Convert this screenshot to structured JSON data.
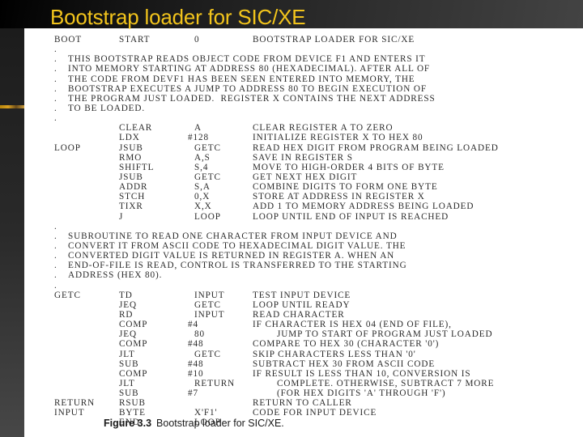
{
  "slide": {
    "title": "Bootstrap loader for SIC/XE"
  },
  "figure": {
    "caption_number": "Figure 3.3",
    "caption_text": "Bootstrap loader for SIC/XE."
  },
  "listing": {
    "header": {
      "label": "BOOT",
      "op": "START",
      "operand": "0",
      "comment": "BOOTSTRAP LOADER FOR SIC/XE"
    },
    "intro_comment": [
      "",
      "THIS BOOTSTRAP READS OBJECT CODE FROM DEVICE F1 AND ENTERS IT",
      "INTO MEMORY STARTING AT ADDRESS 80 (HEXADECIMAL). AFTER ALL OF",
      "THE CODE FROM DEVF1 HAS BEEN SEEN ENTERED INTO MEMORY, THE",
      "BOOTSTRAP EXECUTES A JUMP TO ADDRESS 80 TO BEGIN EXECUTION OF",
      "THE PROGRAM JUST LOADED.  REGISTER X CONTAINS THE NEXT ADDRESS",
      "TO BE LOADED.",
      ""
    ],
    "main_loop": [
      {
        "label": "",
        "op": "CLEAR",
        "operand": "A",
        "comment": "CLEAR REGISTER A TO ZERO"
      },
      {
        "label": "",
        "op": "LDX",
        "operand": "#128",
        "comment": "INITIALIZE REGISTER X TO HEX 80"
      },
      {
        "label": "LOOP",
        "op": "JSUB",
        "operand": "GETC",
        "comment": "READ HEX DIGIT FROM PROGRAM BEING LOADED"
      },
      {
        "label": "",
        "op": "RMO",
        "operand": "A,S",
        "comment": "SAVE IN REGISTER S"
      },
      {
        "label": "",
        "op": "SHIFTL",
        "operand": "S,4",
        "comment": "MOVE TO HIGH-ORDER 4 BITS OF BYTE"
      },
      {
        "label": "",
        "op": "JSUB",
        "operand": "GETC",
        "comment": "GET NEXT HEX DIGIT"
      },
      {
        "label": "",
        "op": "ADDR",
        "operand": "S,A",
        "comment": "COMBINE DIGITS TO FORM ONE BYTE"
      },
      {
        "label": "",
        "op": "STCH",
        "operand": "0,X",
        "comment": "STORE AT ADDRESS IN REGISTER X"
      },
      {
        "label": "",
        "op": "TIXR",
        "operand": "X,X",
        "comment": "ADD 1 TO MEMORY ADDRESS BEING LOADED"
      },
      {
        "label": "",
        "op": "J",
        "operand": "LOOP",
        "comment": "LOOP UNTIL END OF INPUT IS REACHED"
      }
    ],
    "sub_comment": [
      "",
      "SUBROUTINE TO READ ONE CHARACTER FROM INPUT DEVICE AND",
      "CONVERT IT FROM ASCII CODE TO HEXADECIMAL DIGIT VALUE. THE",
      "CONVERTED DIGIT VALUE IS RETURNED IN REGISTER A. WHEN AN",
      "END-OF-FILE IS READ, CONTROL IS TRANSFERRED TO THE STARTING",
      "ADDRESS (HEX 80).",
      ""
    ],
    "getc": [
      {
        "label": "GETC",
        "op": "TD",
        "operand": "INPUT",
        "comment": "TEST INPUT DEVICE"
      },
      {
        "label": "",
        "op": "JEQ",
        "operand": "GETC",
        "comment": "LOOP UNTIL READY"
      },
      {
        "label": "",
        "op": "RD",
        "operand": "INPUT",
        "comment": "READ CHARACTER"
      },
      {
        "label": "",
        "op": "COMP",
        "operand": "#4",
        "comment": "IF CHARACTER IS HEX 04 (END OF FILE),"
      },
      {
        "label": "",
        "op": "JEQ",
        "operand": "80",
        "comment": "JUMP TO START OF PROGRAM JUST LOADED"
      },
      {
        "label": "",
        "op": "COMP",
        "operand": "#48",
        "comment": "COMPARE TO HEX 30 (CHARACTER '0')"
      },
      {
        "label": "",
        "op": "JLT",
        "operand": "GETC",
        "comment": "SKIP CHARACTERS LESS THAN '0'"
      },
      {
        "label": "",
        "op": "SUB",
        "operand": "#48",
        "comment": "SUBTRACT HEX 30 FROM ASCII CODE"
      },
      {
        "label": "",
        "op": "COMP",
        "operand": "#10",
        "comment": "IF RESULT IS LESS THAN 10, CONVERSION IS"
      },
      {
        "label": "",
        "op": "JLT",
        "operand": "RETURN",
        "comment": "COMPLETE. OTHERWISE, SUBTRACT 7 MORE"
      },
      {
        "label": "",
        "op": "SUB",
        "operand": "#7",
        "comment": "(FOR HEX DIGITS 'A' THROUGH 'F')"
      },
      {
        "label": "RETURN",
        "op": "RSUB",
        "operand": "",
        "comment": "RETURN TO CALLER"
      },
      {
        "label": "INPUT",
        "op": "BYTE",
        "operand": "X'F1'",
        "comment": "CODE FOR INPUT DEVICE"
      },
      {
        "label": "",
        "op": "END",
        "operand": "LOOP",
        "comment": ""
      }
    ]
  }
}
